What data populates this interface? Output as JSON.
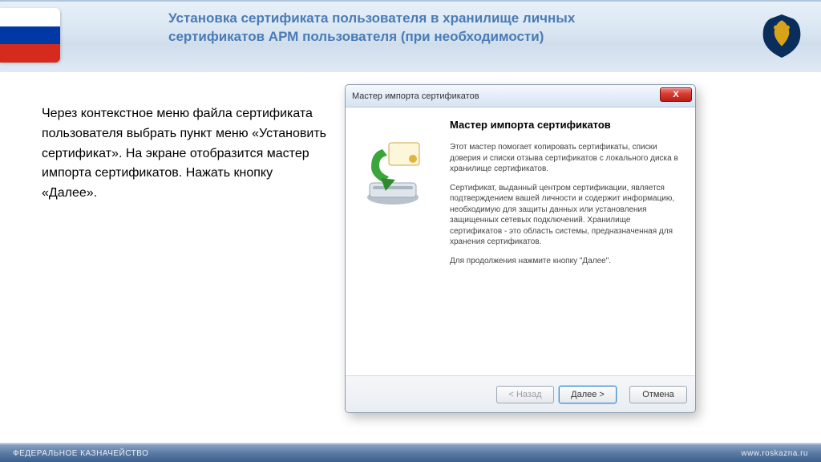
{
  "slide": {
    "title": "Установка сертификата пользователя в хранилище личных сертификатов АРМ пользователя (при необходимости)",
    "body": "Через контекстное меню файла сертификата пользователя выбрать пункт меню «Установить сертификат». На экране отобразится мастер импорта сертификатов. Нажать кнопку «Далее»."
  },
  "window": {
    "titlebar": "Мастер импорта сертификатов",
    "close": "X",
    "heading": "Мастер импорта сертификатов",
    "para1": "Этот мастер помогает копировать сертификаты, списки доверия и списки отзыва сертификатов с локального диска в хранилище сертификатов.",
    "para2": "Сертификат, выданный центром сертификации, является подтверждением вашей личности и содержит информацию, необходимую для защиты данных или установления защищенных сетевых подключений. Хранилище сертификатов - это область системы, предназначенная для хранения сертификатов.",
    "para3": "Для продолжения нажмите кнопку \"Далее\".",
    "buttons": {
      "back": "< Назад",
      "next": "Далее >",
      "cancel": "Отмена"
    }
  },
  "footer": {
    "left": "ФЕДЕРАЛЬНОЕ КАЗНАЧЕЙСТВО",
    "right": "www.roskazna.ru"
  }
}
